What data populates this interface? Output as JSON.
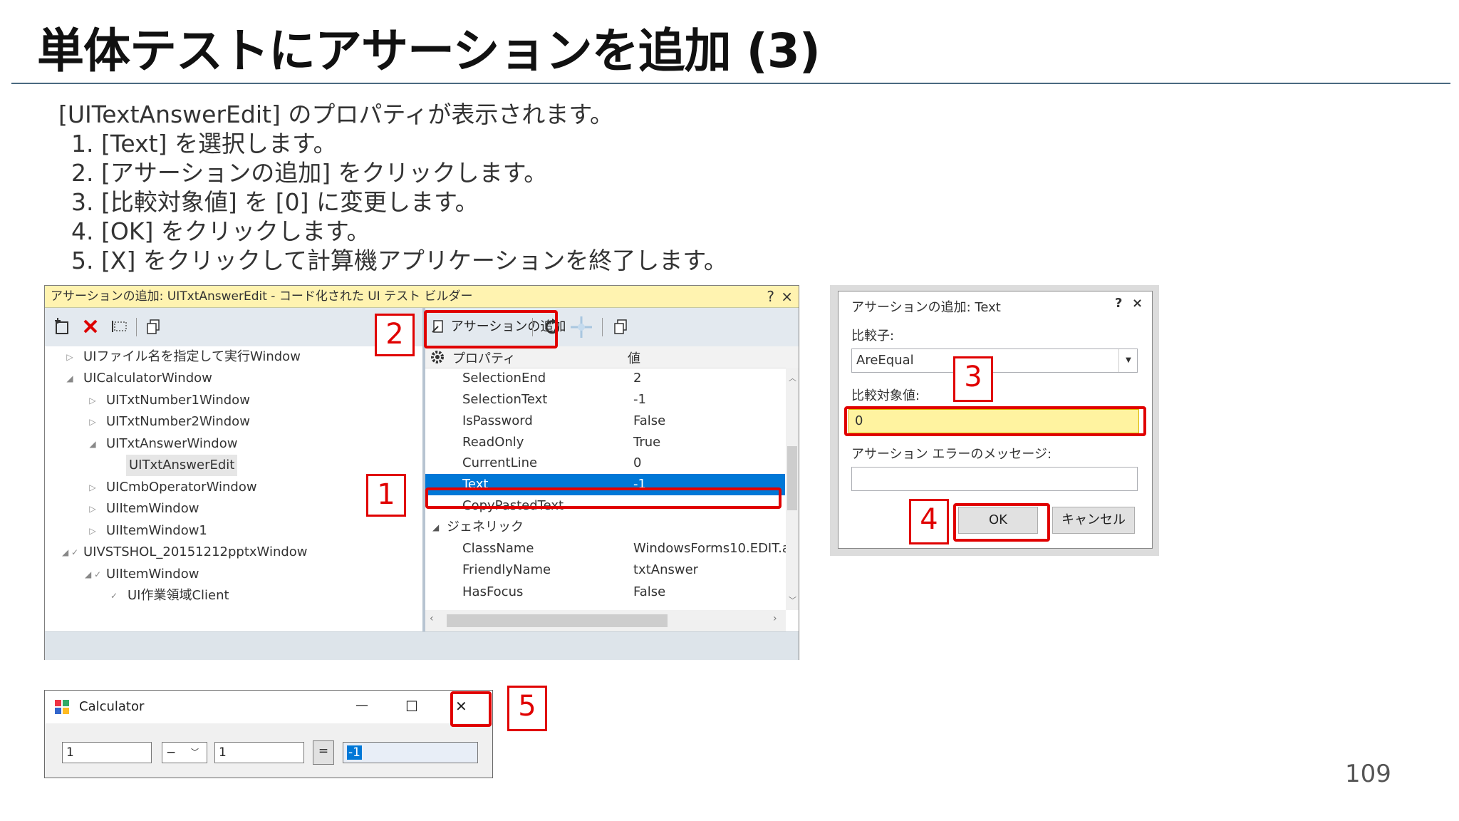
{
  "slide": {
    "title": "単体テストにアサーションを追加 (3)",
    "intro": "[UITextAnswerEdit] のプロパティが表示されます。",
    "steps": [
      "[Text] を選択します。",
      "[アサーションの追加] をクリックします。",
      "[比較対象値] を [0] に変更します。",
      "[OK] をクリックします。",
      "[X] をクリックして計算機アプリケーションを終了します。"
    ],
    "page_number": "109"
  },
  "builder": {
    "title": "アサーションの追加: UITxtAnswerEdit - コード化された UI テスト ビルダー",
    "help": "?",
    "close": "×",
    "add_assertion_label": "アサーションの追加",
    "tree_items": [
      "UIファイル名を指定して実行Window",
      "UICalculatorWindow",
      "UITxtNumber1Window",
      "UITxtNumber2Window",
      "UITxtAnswerWindow",
      "UITxtAnswerEdit",
      "UICmbOperatorWindow",
      "UIItemWindow",
      "UIItemWindow1",
      "UIVSTSHOL_20151212pptxWindow",
      "UIItemWindow",
      "UI作業領域Client"
    ],
    "props_header": {
      "name": "プロパティ",
      "value": "値"
    },
    "properties": [
      {
        "name": "SelectionEnd",
        "value": "2"
      },
      {
        "name": "SelectionText",
        "value": "-1"
      },
      {
        "name": "IsPassword",
        "value": "False"
      },
      {
        "name": "ReadOnly",
        "value": "True"
      },
      {
        "name": "CurrentLine",
        "value": "0"
      },
      {
        "name": "Text",
        "value": "-1"
      },
      {
        "name": "CopyPastedText",
        "value": ""
      }
    ],
    "generic_group": "ジェネリック",
    "generic_properties": [
      {
        "name": "ClassName",
        "value": "WindowsForms10.EDIT.a"
      },
      {
        "name": "FriendlyName",
        "value": "txtAnswer"
      },
      {
        "name": "HasFocus",
        "value": "False"
      }
    ]
  },
  "dialog": {
    "title": "アサーションの追加: Text",
    "help": "?",
    "close": "×",
    "comparator_label": "比較子:",
    "comparator_value": "AreEqual",
    "compare_value_label": "比較対象値:",
    "compare_value": "0",
    "error_message_label": "アサーション エラーのメッセージ:",
    "error_message_value": "",
    "ok_label": "OK",
    "cancel_label": "キャンセル"
  },
  "calculator": {
    "title": "Calculator",
    "minimize": "—",
    "maximize": "☐",
    "close": "✕",
    "number1": "1",
    "operator": "−",
    "number2": "1",
    "equals": "=",
    "answer": "-1"
  },
  "callouts": [
    "1",
    "2",
    "3",
    "4",
    "5"
  ],
  "colors": {
    "highlight_red": "#e00000",
    "selection_blue": "#0078d7",
    "field_yellow": "#fff3a0",
    "builder_title": "#fff3b0"
  }
}
